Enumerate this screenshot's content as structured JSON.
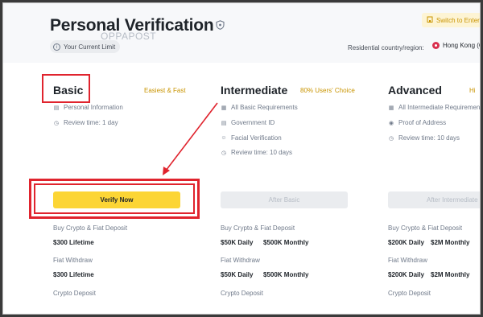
{
  "header": {
    "title": "Personal Verification",
    "watermark": "OPPAPOST",
    "current_limit_label": "Your Current Limit",
    "switch_button_label": "Switch to Enterprise",
    "region_label": "Residential country/region:",
    "region_value": "Hong Kong (China)"
  },
  "tiers": {
    "basic": {
      "name": "Basic",
      "tagline": "Easiest & Fast",
      "requirements": [
        "Personal Information",
        "Review time: 1 day"
      ],
      "button_label": "Verify Now",
      "buy_label": "Buy Crypto & Fiat Deposit",
      "buy_value": "$300 Lifetime",
      "withdraw_label": "Fiat Withdraw",
      "withdraw_value": "$300 Lifetime",
      "crypto_deposit_label": "Crypto Deposit"
    },
    "intermediate": {
      "name": "Intermediate",
      "tagline": "80% Users' Choice",
      "requirements": [
        "All Basic Requirements",
        "Government ID",
        "Facial Verification",
        "Review time: 10 days"
      ],
      "button_label": "After Basic",
      "buy_label": "Buy Crypto & Fiat Deposit",
      "buy_daily": "$50K Daily",
      "buy_monthly": "$500K Monthly",
      "withdraw_label": "Fiat Withdraw",
      "withdraw_daily": "$50K Daily",
      "withdraw_monthly": "$500K Monthly",
      "crypto_deposit_label": "Crypto Deposit"
    },
    "advanced": {
      "name": "Advanced",
      "tagline": "Hi",
      "requirements": [
        "All Intermediate Requirements",
        "Proof of Address",
        "Review time: 10 days"
      ],
      "button_label": "After Intermediate",
      "buy_label": "Buy Crypto & Fiat Deposit",
      "buy_daily": "$200K Daily",
      "buy_monthly": "$2M Monthly",
      "withdraw_label": "Fiat Withdraw",
      "withdraw_daily": "$200K Daily",
      "withdraw_monthly": "$2M Monthly",
      "crypto_deposit_label": "Crypto Deposit"
    }
  },
  "colors": {
    "accent": "#fcd535",
    "tagline": "#c99400",
    "annotation": "#e0242e"
  }
}
